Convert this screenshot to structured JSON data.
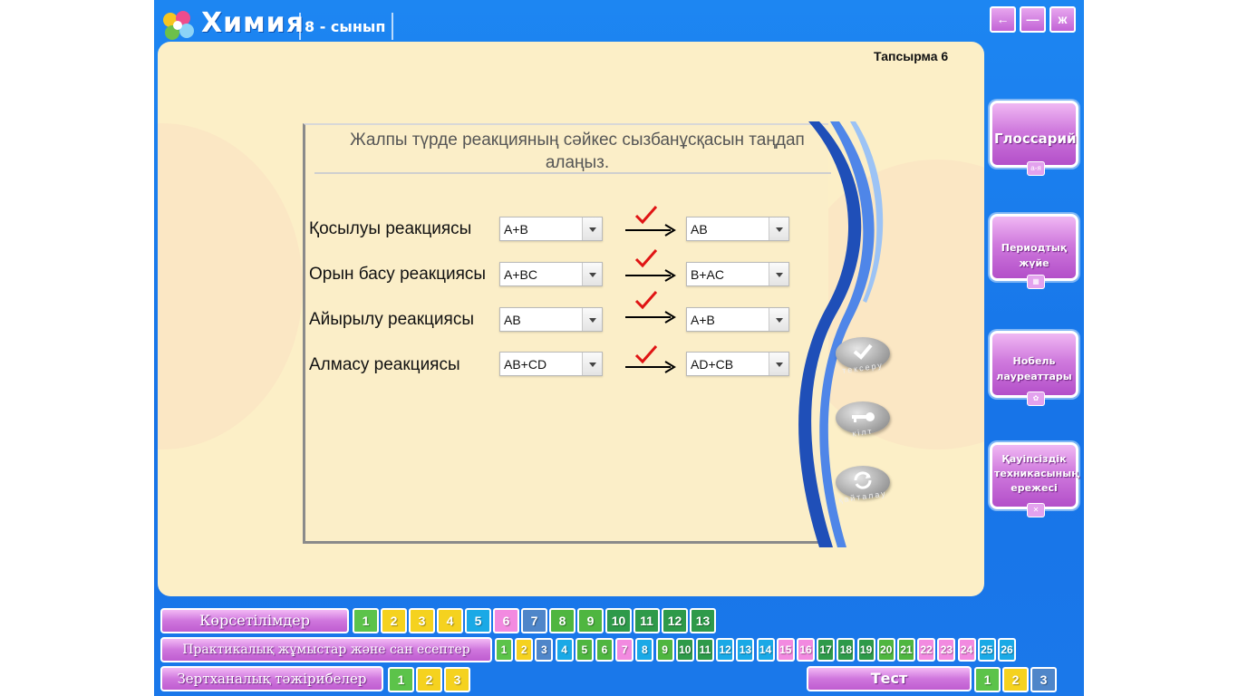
{
  "header": {
    "title": "Химия",
    "grade": "8 - сынып",
    "window_buttons": [
      "←",
      "—",
      "ж"
    ]
  },
  "task": {
    "label": "Тапсырма 6",
    "instruction_line1": "Жалпы түрде реакцияның сәйкес сызбанұсқасын таңдап",
    "instruction_line2": "алаңыз.",
    "rows": [
      {
        "name": "Қосылуы реакциясы",
        "left": "A+B",
        "right": "AB"
      },
      {
        "name": "Орын басу реакциясы",
        "left": "A+BC",
        "right": "B+AC"
      },
      {
        "name": "Айырылу реакциясы",
        "left": "AB",
        "right": "A+B"
      },
      {
        "name": "Алмасу реакциясы",
        "left": "AB+CD",
        "right": "AD+CB"
      }
    ],
    "check_label": "тексеру",
    "key_label": "кілт",
    "retry_label": "қайталау"
  },
  "sidebar": {
    "glossary_label": "Глоссарий",
    "glossary_icon": "а-я",
    "periodic_label_1": "Периодтық",
    "periodic_label_2": "жүйе",
    "nobel_label_1": "Нобель",
    "nobel_label_2": "лауреаттары",
    "safety_label_1": "Қауіпсіздік",
    "safety_label_2": "техникасының",
    "safety_label_3": "ережесі"
  },
  "bottom": {
    "demos_label": "Көрсетілімдер",
    "demos_numbers": [
      "1",
      "2",
      "3",
      "4",
      "5",
      "6",
      "7",
      "8",
      "9",
      "10",
      "11",
      "12",
      "13"
    ],
    "practical_label": "Практикалық жұмыстар және сан есептер",
    "practical_numbers": [
      "1",
      "2",
      "3",
      "4",
      "5",
      "6",
      "7",
      "8",
      "9",
      "10",
      "11",
      "12",
      "13",
      "14",
      "15",
      "16",
      "17",
      "18",
      "19",
      "20",
      "21",
      "22",
      "23",
      "24",
      "25",
      "26"
    ],
    "lab_label": "Зертханалық тәжірибелер",
    "lab_numbers": [
      "1",
      "2",
      "3"
    ],
    "test_label": "Тест",
    "test_numbers": [
      "1",
      "2",
      "3"
    ]
  },
  "colors": {
    "demos": [
      "#5cc34a",
      "#f5d21f",
      "#f5d21f",
      "#f5d21f",
      "#1aa9e6",
      "#f28ae0",
      "#4f86c9",
      "#4fb640",
      "#4fb640",
      "#2e9a4a",
      "#2e9a4a",
      "#2e9a4a",
      "#2e9a4a"
    ],
    "practical": [
      "#5cc34a",
      "#f5d21f",
      "#4f86c9",
      "#1aa9e6",
      "#4fb640",
      "#4fb640",
      "#f28ae0",
      "#1aa9e6",
      "#4fb640",
      "#2e9a4a",
      "#2e9a4a",
      "#1aa9e6",
      "#1aa9e6",
      "#1aa9e6",
      "#f28ae0",
      "#f28ae0",
      "#2e9a4a",
      "#2e9a4a",
      "#2e9a4a",
      "#4fb640",
      "#4fb640",
      "#f28ae0",
      "#f28ae0",
      "#f28ae0",
      "#1aa9e6",
      "#1aa9e6"
    ],
    "lab": [
      "#5cc34a",
      "#f5d21f",
      "#f5d21f"
    ],
    "test": [
      "#5cc34a",
      "#f5d21f",
      "#4f86c9"
    ]
  }
}
